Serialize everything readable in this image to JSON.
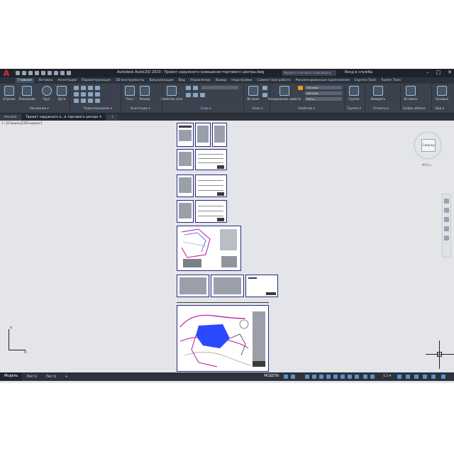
{
  "titlebar": {
    "logo": "A",
    "title": "Autodesk AutoCAD 2020 · Проект наружного освещения торгового центра.dwg",
    "search_placeholder": "Введите ключевое слово/фразу",
    "login": "Вход в службы",
    "win_min": "–",
    "win_max": "□",
    "win_close": "✕"
  },
  "ribbon_tabs": [
    "Главная",
    "Вставка",
    "Аннотации",
    "Параметризация",
    "3D-инструменты",
    "Визуализация",
    "Вид",
    "Управление",
    "Вывод",
    "Надстройки",
    "Совместная работа",
    "Рекомендованные приложения",
    "Express Tools",
    "Raster Tools"
  ],
  "ribbon": {
    "tools": {
      "line": "Отрезок",
      "polyline": "Полилиния",
      "circle": "Круг",
      "arc": "Дуга",
      "text": "Текст",
      "dimension": "Размер",
      "layer_props": "Свойства слоя",
      "insert": "Вставка",
      "match_props": "Копирование свойств",
      "group": "Группа",
      "measure": "Измерить",
      "paste": "Вставить",
      "base": "Базовый"
    },
    "panels": {
      "draw": "Рисование ▾",
      "modify": "Редактирование ▾",
      "annotation": "Аннотации ▾",
      "layers": "Слои ▾",
      "block": "Блок ▾",
      "properties": "Свойства ▾",
      "groups": "Группы ▾",
      "utilities": "Утилиты ▾",
      "clipboard": "Буфер обмена",
      "view": "Вид ▾"
    },
    "bylayer_1": "ПоСлою",
    "bylayer_2": "ПоСлою",
    "bylayer_3": "ПоСл..."
  },
  "doc_tabs": {
    "start": "Начало",
    "drawing": "Проект наружного о...в торгового центра",
    "close": "✕",
    "add": "+"
  },
  "canvas": {
    "view_label": "[−][Сверху][2D-каркас]",
    "viewcube_face": "Сверху",
    "wcs_label": "МСК ▾",
    "ucs_x": "X",
    "ucs_y": "Y"
  },
  "layout_tabs": [
    "Модель",
    "Лист1",
    "Лист2"
  ],
  "layout_add": "+",
  "status": {
    "model": "МОДЕЛЬ",
    "scale": "1:1 ▾"
  },
  "colors": {
    "title_bg": "#1e232b",
    "ribbon_bg": "#3b424d",
    "canvas_bg": "#e3e5e8",
    "sheet_border": "#2a2a80",
    "site_blue": "#2b49ff",
    "site_magenta": "#c0149a"
  }
}
